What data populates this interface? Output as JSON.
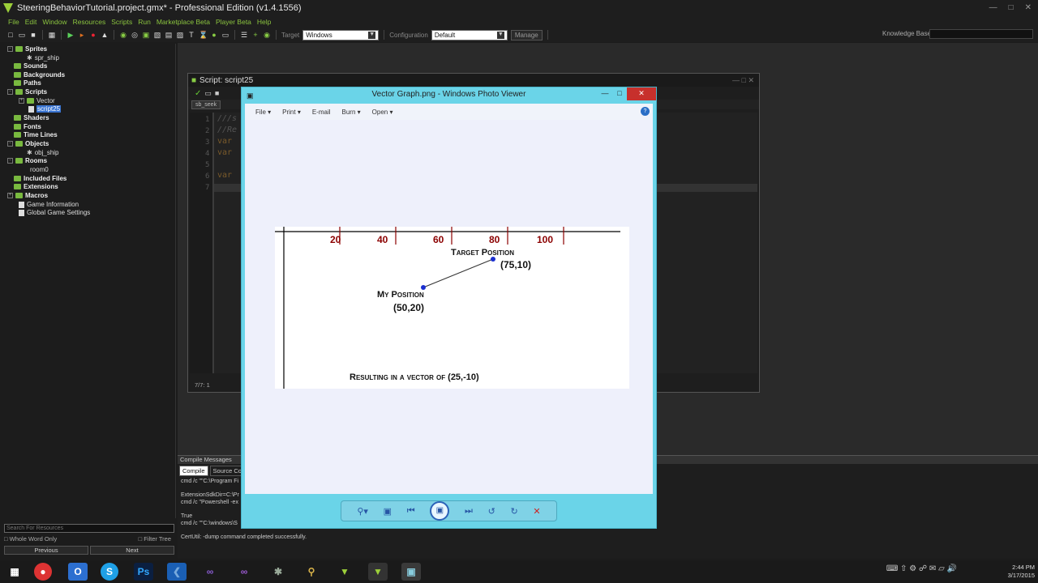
{
  "app": {
    "title": "SteeringBehaviorTutorial.project.gmx* - Professional Edition (v1.4.1556)",
    "win_min": "—",
    "win_max": "□",
    "win_close": "✕"
  },
  "menu": [
    "File",
    "Edit",
    "Window",
    "Resources",
    "Scripts",
    "Run",
    "Marketplace Beta",
    "Player Beta",
    "Help"
  ],
  "toolbar": {
    "target_label": "Target",
    "target_value": "Windows",
    "config_label": "Configuration",
    "config_value": "Default",
    "manage": "Manage",
    "kb_label": "Knowledge Base:"
  },
  "tree": [
    {
      "label": "Sprites",
      "level": 0,
      "type": "folder"
    },
    {
      "label": "spr_ship",
      "level": 1,
      "type": "sprite"
    },
    {
      "label": "Sounds",
      "level": 0,
      "type": "folder"
    },
    {
      "label": "Backgrounds",
      "level": 0,
      "type": "folder"
    },
    {
      "label": "Paths",
      "level": 0,
      "type": "folder"
    },
    {
      "label": "Scripts",
      "level": 0,
      "type": "folder"
    },
    {
      "label": "Vector",
      "level": 1,
      "type": "folder"
    },
    {
      "label": "script25",
      "level": 1,
      "type": "script",
      "selected": true
    },
    {
      "label": "Shaders",
      "level": 0,
      "type": "folder"
    },
    {
      "label": "Fonts",
      "level": 0,
      "type": "folder"
    },
    {
      "label": "Time Lines",
      "level": 0,
      "type": "folder"
    },
    {
      "label": "Objects",
      "level": 0,
      "type": "folder"
    },
    {
      "label": "obj_ship",
      "level": 1,
      "type": "object"
    },
    {
      "label": "Rooms",
      "level": 0,
      "type": "folder"
    },
    {
      "label": "room0",
      "level": 1,
      "type": "room"
    },
    {
      "label": "Included Files",
      "level": 0,
      "type": "folder"
    },
    {
      "label": "Extensions",
      "level": 0,
      "type": "folder"
    },
    {
      "label": "Macros",
      "level": 0,
      "type": "folder"
    },
    {
      "label": "Game Information",
      "level": 0,
      "type": "info"
    },
    {
      "label": "Global Game Settings",
      "level": 0,
      "type": "info"
    }
  ],
  "search": {
    "placeholder": "Search For Resources",
    "whole_word": "Whole Word Only",
    "filter": "Filter Tree",
    "previous": "Previous",
    "next": "Next"
  },
  "script": {
    "title": "Script: script25",
    "tab": "sb_seek",
    "lines": [
      "1",
      "2",
      "3",
      "4",
      "5",
      "6",
      "7"
    ],
    "code": [
      "///s",
      "//Re",
      "var",
      "var",
      "",
      "var",
      ""
    ],
    "status": "7/7:   1"
  },
  "compile": {
    "title": "Compile Messages",
    "tab_compile": "Compile",
    "tab_source": "Source Cont",
    "log": [
      "cmd /c \"\"C:\\Program Fi",
      "",
      "ExtensionSdkDir=C:\\Pr",
      "cmd /c \"Powershell -ex",
      "",
      "True",
      "cmd /c \"\"C:\\windows\\S",
      "",
      "CertUtil: -dump command completed successfully."
    ]
  },
  "viewer": {
    "title": "Vector Graph.png - Windows Photo Viewer",
    "menu": [
      "File",
      "Print",
      "E-mail",
      "Burn",
      "Open"
    ],
    "help": "?"
  },
  "graph": {
    "x_ticks": [
      "20",
      "40",
      "60",
      "80",
      "100"
    ],
    "target_label": "Target Position",
    "target_coords": "(75,10)",
    "mine_label": "My Position",
    "mine_coords": "(50,20)",
    "caption": "Resulting in a vector of (25,-10)",
    "accent": "#8b0000"
  },
  "taskbar": {
    "time": "2:44 PM",
    "date": "3/17/2015",
    "apps": [
      "windows-icon",
      "chrome-icon",
      "outlook-icon",
      "skype-icon",
      "photoshop-icon",
      "vscode-icon",
      "visual-studio-icon",
      "visual-studio-2-icon",
      "turtle-icon",
      "search-tool-icon",
      "gamemaker-icon",
      "gamemaker-2-icon",
      "photo-viewer-icon"
    ]
  }
}
